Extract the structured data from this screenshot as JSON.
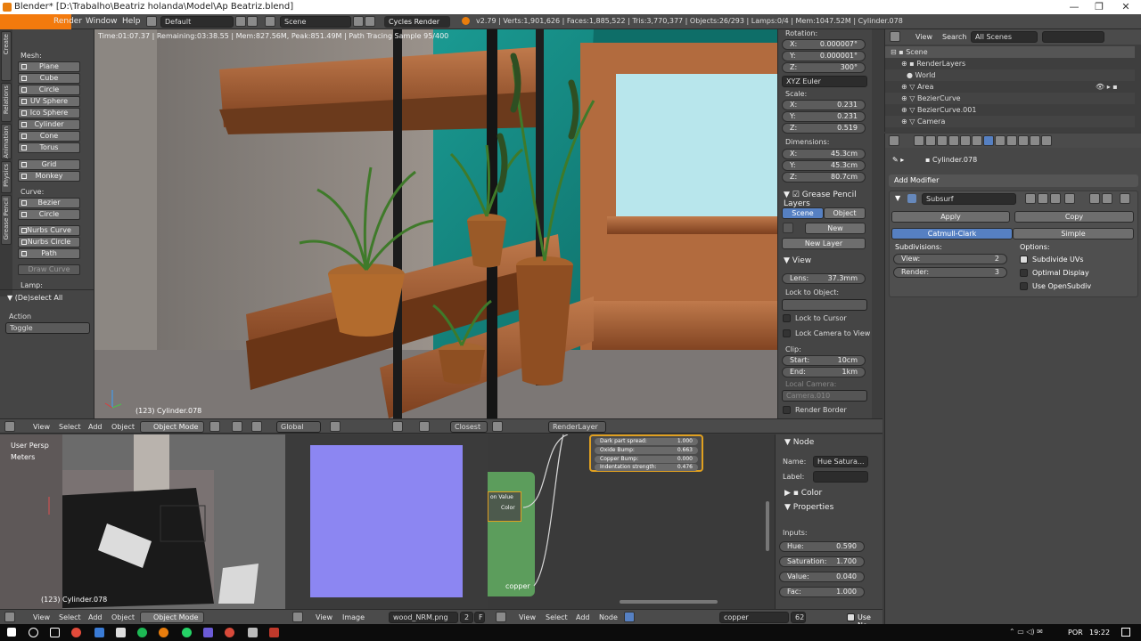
{
  "window": {
    "title": "Blender* [D:\\Trabalho\\Beatriz holanda\\Model\\Ap Beatriz.blend]",
    "minimize": "—",
    "maximize": "❐",
    "close": "✕"
  },
  "topbar": {
    "menu": [
      "Render",
      "Window",
      "Help"
    ],
    "layout": "Default",
    "scene": "Scene",
    "engine": "Cycles Render",
    "stats": "v2.79 | Verts:1,901,626 | Faces:1,885,522 | Tris:3,770,377 | Objects:26/293 | Lamps:0/4 | Mem:1047.52M | Cylinder.078"
  },
  "toolshelf": {
    "tabs": [
      "Create",
      "Relations",
      "Animation",
      "Physics",
      "Grease Pencil"
    ],
    "mesh_label": "Mesh:",
    "mesh": [
      "Plane",
      "Cube",
      "Circle",
      "UV Sphere",
      "Ico Sphere",
      "Cylinder",
      "Cone",
      "Torus",
      "Grid",
      "Monkey"
    ],
    "curve_label": "Curve:",
    "curve": [
      "Bezier",
      "Circle",
      "Nurbs Curve",
      "Nurbs Circle",
      "Path",
      "Draw Curve"
    ],
    "lamp_label": "Lamp:",
    "deselect": "(De)select All",
    "action_label": "Action",
    "action_value": "Toggle"
  },
  "viewport": {
    "render_info": "Time:01:07.37 | Remaining:03:38.55 | Mem:827.56M, Peak:851.49M | Path Tracing Sample 95/400",
    "object_label": "(123) Cylinder.078"
  },
  "npanel": {
    "rotation_label": "Rotation:",
    "rotation": [
      {
        "k": "X:",
        "v": "0.000007°"
      },
      {
        "k": "Y:",
        "v": "0.000001°"
      },
      {
        "k": "Z:",
        "v": "300°"
      }
    ],
    "euler": "XYZ Euler",
    "scale_label": "Scale:",
    "scale": [
      {
        "k": "X:",
        "v": "0.231"
      },
      {
        "k": "Y:",
        "v": "0.231"
      },
      {
        "k": "Z:",
        "v": "0.519"
      }
    ],
    "dimensions_label": "Dimensions:",
    "dimensions": [
      {
        "k": "X:",
        "v": "45.3cm"
      },
      {
        "k": "Y:",
        "v": "45.3cm"
      },
      {
        "k": "Z:",
        "v": "80.7cm"
      }
    ],
    "grease_pencil": "Grease Pencil Layers",
    "gp_scene": "Scene",
    "gp_object": "Object",
    "gp_new": "New",
    "gp_new_layer": "New Layer",
    "view_head": "View",
    "lens_k": "Lens:",
    "lens_v": "37.3mm",
    "lock_object": "Lock to Object:",
    "lock_cursor": "Lock to Cursor",
    "lock_camera": "Lock Camera to View",
    "clip": "Clip:",
    "clip_start_k": "Start:",
    "clip_start_v": "10cm",
    "clip_end_k": "End:",
    "clip_end_v": "1km",
    "local_camera": "Local Camera:",
    "camera_field": "Camera.010",
    "render_border": "Render Border"
  },
  "outliner": {
    "view": "View",
    "search": "Search",
    "filter": "All Scenes",
    "rows": [
      "Scene",
      "RenderLayers",
      "World",
      "Area",
      "BezierCurve",
      "BezierCurve.001",
      "Camera"
    ]
  },
  "properties": {
    "object": "Cylinder.078",
    "add_modifier": "Add Modifier",
    "modifier_name": "Subsurf",
    "apply": "Apply",
    "copy": "Copy",
    "catmull": "Catmull-Clark",
    "simple": "Simple",
    "subdivisions": "Subdivisions:",
    "options": "Options:",
    "view_k": "View:",
    "view_v": "2",
    "render_k": "Render:",
    "render_v": "3",
    "subdivide_uvs": "Subdivide UVs",
    "optimal_display": "Optimal Display",
    "use_opensubdiv": "Use OpenSubdiv"
  },
  "viewport_header": {
    "items": [
      "View",
      "Select",
      "Add",
      "Object"
    ],
    "mode": "Object Mode",
    "orientation": "Global",
    "snap": "Closest",
    "render_layer": "RenderLayer"
  },
  "bottom_viewport": {
    "persp": "User Persp",
    "units": "Meters",
    "object_label": "(123) Cylinder.078"
  },
  "node_editor": {
    "props": [
      {
        "k": "Dark part spread:",
        "v": "1.000"
      },
      {
        "k": "Oxide Bump:",
        "v": "0.663"
      },
      {
        "k": "Copper Bump:",
        "v": "0.000"
      },
      {
        "k": "Indentation strength:",
        "v": "0.476"
      }
    ],
    "node_label": "copper",
    "value_label": "on Value",
    "color_label": "Color"
  },
  "node_panel": {
    "node_head": "Node",
    "name_k": "Name:",
    "name_v": "Hue Satura...",
    "label_k": "Label:",
    "color_head": "Color",
    "properties_head": "Properties",
    "inputs": "Inputs:",
    "hue_k": "Hue:",
    "hue_v": "0.590",
    "sat_k": "Saturation:",
    "sat_v": "1.700",
    "val_k": "Value:",
    "val_v": "0.040",
    "fac_k": "Fac:",
    "fac_v": "1.000"
  },
  "footer": {
    "items": [
      "View",
      "Select",
      "Add",
      "Object"
    ],
    "mode": "Object Mode",
    "img_view": "View",
    "img_image": "Image",
    "image_name": "wood_NRM.png",
    "image_users": "2",
    "image_f": "F",
    "node_items": [
      "View",
      "Select",
      "Add",
      "Node"
    ],
    "material": "copper",
    "material_users": "62",
    "use_nodes": "Use No"
  },
  "taskbar": {
    "lang": "POR",
    "time": "19:22"
  }
}
